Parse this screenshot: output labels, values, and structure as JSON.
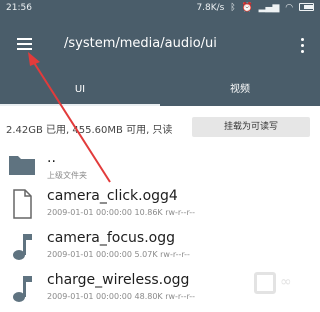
{
  "statusbar": {
    "time": "21:56",
    "network_speed": "7.8K/s",
    "bluetooth_icon": "ᛒ",
    "battery_icon": "battery-icon"
  },
  "toolbar": {
    "menu_icon": "hamburger-menu-icon",
    "path": "/system/media/audio/ui",
    "more_icon": "more-vertical-icon"
  },
  "tabs": [
    {
      "label": "UI",
      "active": true
    },
    {
      "label": "视频",
      "active": false
    }
  ],
  "storage": {
    "summary": "2.42GB 已用, 455.60MB 可用, 只读",
    "remount_button": "挂载为可读写"
  },
  "files": [
    {
      "name": "..",
      "meta": "上级文件夹",
      "icon": "folder-icon"
    },
    {
      "name": "camera_click.ogg4",
      "meta": "2009-01-01 00:00:00  10.86K  rw-r--r--",
      "icon": "file-icon"
    },
    {
      "name": "camera_focus.ogg",
      "meta": "2009-01-01 00:00:00  5.07K  rw-r--r--",
      "icon": "music-note-icon"
    },
    {
      "name": "charge_wireless.ogg",
      "meta": "2009-01-01 00:00:00  48.80K  rw-r--r--",
      "icon": "music-note-icon"
    }
  ],
  "colors": {
    "toolbar_bg": "#4a5d6a",
    "annotation_arrow": "#e23b3b",
    "icon_fill": "#5f7380"
  }
}
